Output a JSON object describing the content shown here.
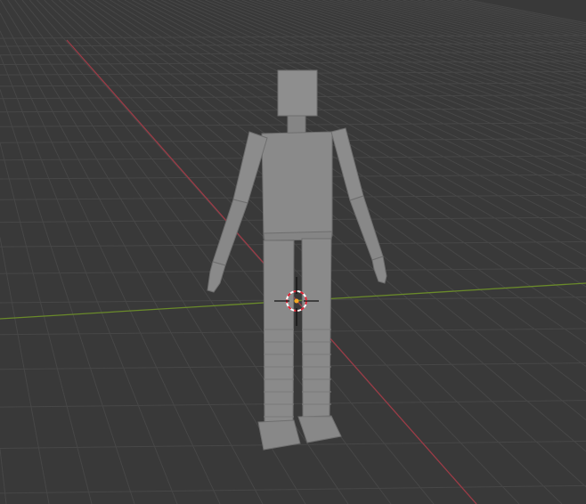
{
  "viewport": {
    "background_color": "#393939",
    "grid_color": "#474747",
    "x_axis_color": "#9c3b46",
    "y_axis_color": "#6a8a2a",
    "mesh_color": "#8a8a8a",
    "mesh_edge_color": "#6e6e6e"
  },
  "cursor": {
    "icon": "3d-cursor-icon"
  }
}
